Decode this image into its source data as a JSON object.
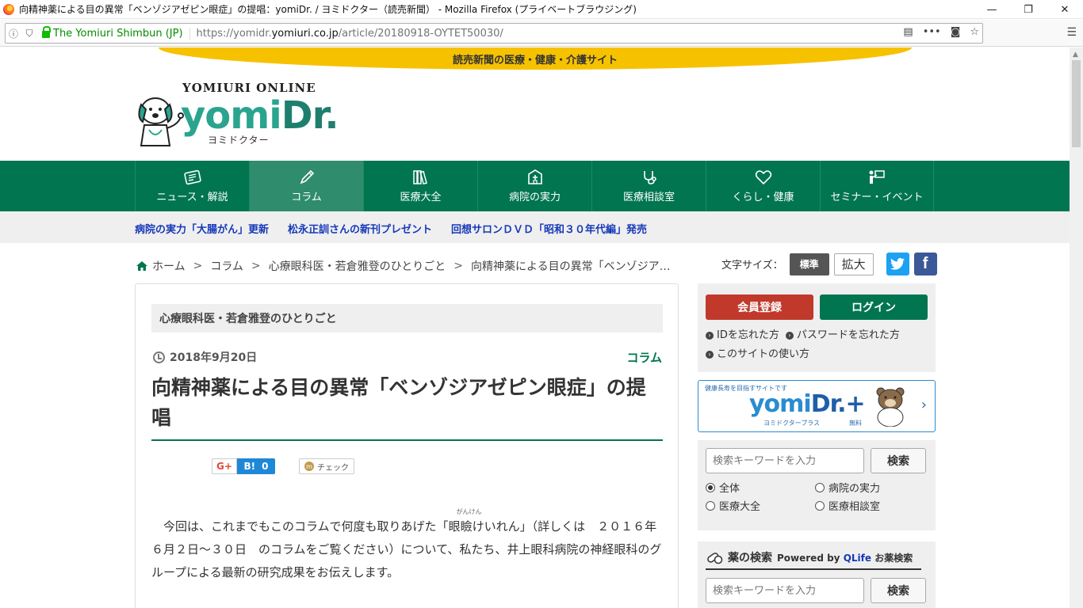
{
  "browser": {
    "window_title": "向精神薬による目の異常「ベンゾジアゼピン眼症」の提唱：yomiDr. / ヨミドクター（読売新聞） - Mozilla Firefox (プライベートブラウジング)",
    "site_identity": "The Yomiuri Shimbun (JP)",
    "url_prefix": "https://yomidr.",
    "url_domain": "yomiuri.co.jp",
    "url_path": "/article/20180918-OYTET50030/",
    "win_minimize": "—",
    "win_restore": "❐",
    "win_close": "✕"
  },
  "site": {
    "banner_text": "読売新聞の医療・健康・介護サイト",
    "logo_top": "YOMIURI ONLINE",
    "logo_main_a": "yomi",
    "logo_main_b": "Dr.",
    "logo_kana": "ヨミドクター"
  },
  "nav": [
    {
      "label": "ニュース・解説",
      "icon": "newspaper-icon"
    },
    {
      "label": "コラム",
      "icon": "pencil-icon",
      "active": true
    },
    {
      "label": "医療大全",
      "icon": "books-icon"
    },
    {
      "label": "病院の実力",
      "icon": "hospital-icon"
    },
    {
      "label": "医療相談室",
      "icon": "stethoscope-icon"
    },
    {
      "label": "くらし・健康",
      "icon": "heart-icon"
    },
    {
      "label": "セミナー・イベント",
      "icon": "presenter-icon"
    }
  ],
  "news_links": [
    "病院の実力「大腸がん」更新",
    "松永正訓さんの新刊プレゼント",
    "回想サロンＤＶＤ「昭和３０年代編」発売"
  ],
  "breadcrumb": {
    "sep": ">",
    "items": [
      "ホーム",
      "コラム",
      "心療眼科医・若倉雅登のひとりごと",
      "向精神薬による目の異常「ベンゾジア…"
    ]
  },
  "font_size": {
    "label": "文字サイズ：",
    "standard": "標準",
    "large": "拡大"
  },
  "article": {
    "category": "心療眼科医・若倉雅登のひとりごと",
    "date": "2018年9月20日",
    "tag": "コラム",
    "title": "向精神薬による目の異常「ベンゾジアゼピン眼症」の提唱",
    "share": {
      "gplus": "G+",
      "hatena": "B!",
      "hatena_count": "0",
      "check": "チェック"
    },
    "body_before": "　今回は、これまでもこのコラムで何度も取りあげた「",
    "ruby_base": "眼瞼",
    "ruby_text": "がんけん",
    "body_after": "けいれん」（詳しくは　２０１６年６月２日～３０日　のコラムをご覧ください）について、私たち、井上眼科病院の神経眼科のグループによる最新の研究成果をお伝えします。"
  },
  "sidebar": {
    "register": "会員登録",
    "login": "ログイン",
    "forgot_id": "IDを忘れた方",
    "forgot_pw": "パスワードを忘れた方",
    "how_to": "このサイトの使い方",
    "plus_sub": "健康長寿を目指すサイトです",
    "plus_brand_a": "yomi",
    "plus_brand_b": "Dr.+",
    "plus_kana": "ヨミドクタープラス",
    "plus_free": "無料",
    "plus_chevron": "›",
    "search_placeholder": "検索キーワードを入力",
    "search_button": "検索",
    "radios": [
      {
        "label": "全体",
        "checked": true
      },
      {
        "label": "病院の実力",
        "checked": false
      },
      {
        "label": "医療大全",
        "checked": false
      },
      {
        "label": "医療相談室",
        "checked": false
      }
    ],
    "drug_title": "薬の検索",
    "drug_powered": "Powered by",
    "drug_qlife": "QLife",
    "drug_service": "お薬検索",
    "drug_placeholder": "検索キーワードを入力",
    "drug_button": "検索"
  },
  "colors": {
    "brand_green": "#00754f",
    "banner_yellow": "#f6c200",
    "link_blue": "#1639b8",
    "register_red": "#c0392b"
  }
}
